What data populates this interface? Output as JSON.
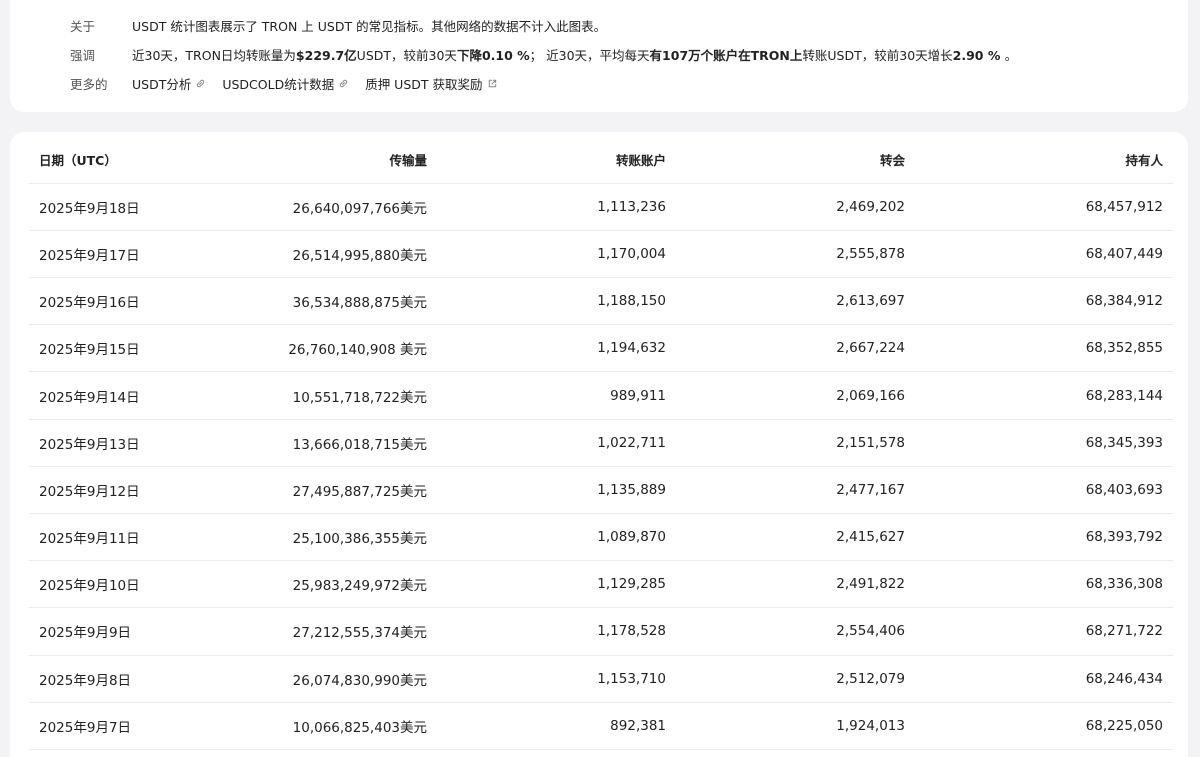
{
  "info": {
    "about_label": "关于",
    "about_text": "USDT 统计图表展示了 TRON 上 USDT 的常见指标。其他网络的数据不计入此图表。",
    "highlight_label": "强调",
    "hl_p1": "近30天，TRON日均转账量为",
    "hl_b1": "$229.7亿",
    "hl_p2": "USDT，较前30天",
    "hl_b2": "下降0.10 %",
    "hl_p3": "；  近30天，平均每天",
    "hl_b3": "有107万个账户在TRON上",
    "hl_p4": "转账USDT，较前30天增长",
    "hl_b4": "2.90 % ",
    "hl_p5": "。",
    "more_label": "更多的",
    "links": [
      {
        "label": "USDT分析",
        "icon": "link-icon"
      },
      {
        "label": "USDCOLD统计数据",
        "icon": "link-icon"
      },
      {
        "label": "质押 USDT 获取奖励",
        "icon": "external-link-icon"
      }
    ]
  },
  "table": {
    "headers": [
      "日期（UTC）",
      "传输量",
      "转账账户",
      "转会",
      "持有人"
    ],
    "rows": [
      [
        "2025年9月18日",
        "26,640,097,766美元",
        "1,113,236",
        "2,469,202",
        "68,457,912"
      ],
      [
        "2025年9月17日",
        "26,514,995,880美元",
        "1,170,004",
        "2,555,878",
        "68,407,449"
      ],
      [
        "2025年9月16日",
        "36,534,888,875美元",
        "1,188,150",
        "2,613,697",
        "68,384,912"
      ],
      [
        "2025年9月15日",
        "26,760,140,908 美元",
        "1,194,632",
        "2,667,224",
        "68,352,855"
      ],
      [
        "2025年9月14日",
        "10,551,718,722美元",
        "989,911",
        "2,069,166",
        "68,283,144"
      ],
      [
        "2025年9月13日",
        "13,666,018,715美元",
        "1,022,711",
        "2,151,578",
        "68,345,393"
      ],
      [
        "2025年9月12日",
        "27,495,887,725美元",
        "1,135,889",
        "2,477,167",
        "68,403,693"
      ],
      [
        "2025年9月11日",
        "25,100,386,355美元",
        "1,089,870",
        "2,415,627",
        "68,393,792"
      ],
      [
        "2025年9月10日",
        "25,983,249,972美元",
        "1,129,285",
        "2,491,822",
        "68,336,308"
      ],
      [
        "2025年9月9日",
        "27,212,555,374美元",
        "1,178,528",
        "2,554,406",
        "68,271,722"
      ],
      [
        "2025年9月8日",
        "26,074,830,990美元",
        "1,153,710",
        "2,512,079",
        "68,246,434"
      ],
      [
        "2025年9月7日",
        "10,066,825,403美元",
        "892,381",
        "1,924,013",
        "68,225,050"
      ]
    ]
  }
}
